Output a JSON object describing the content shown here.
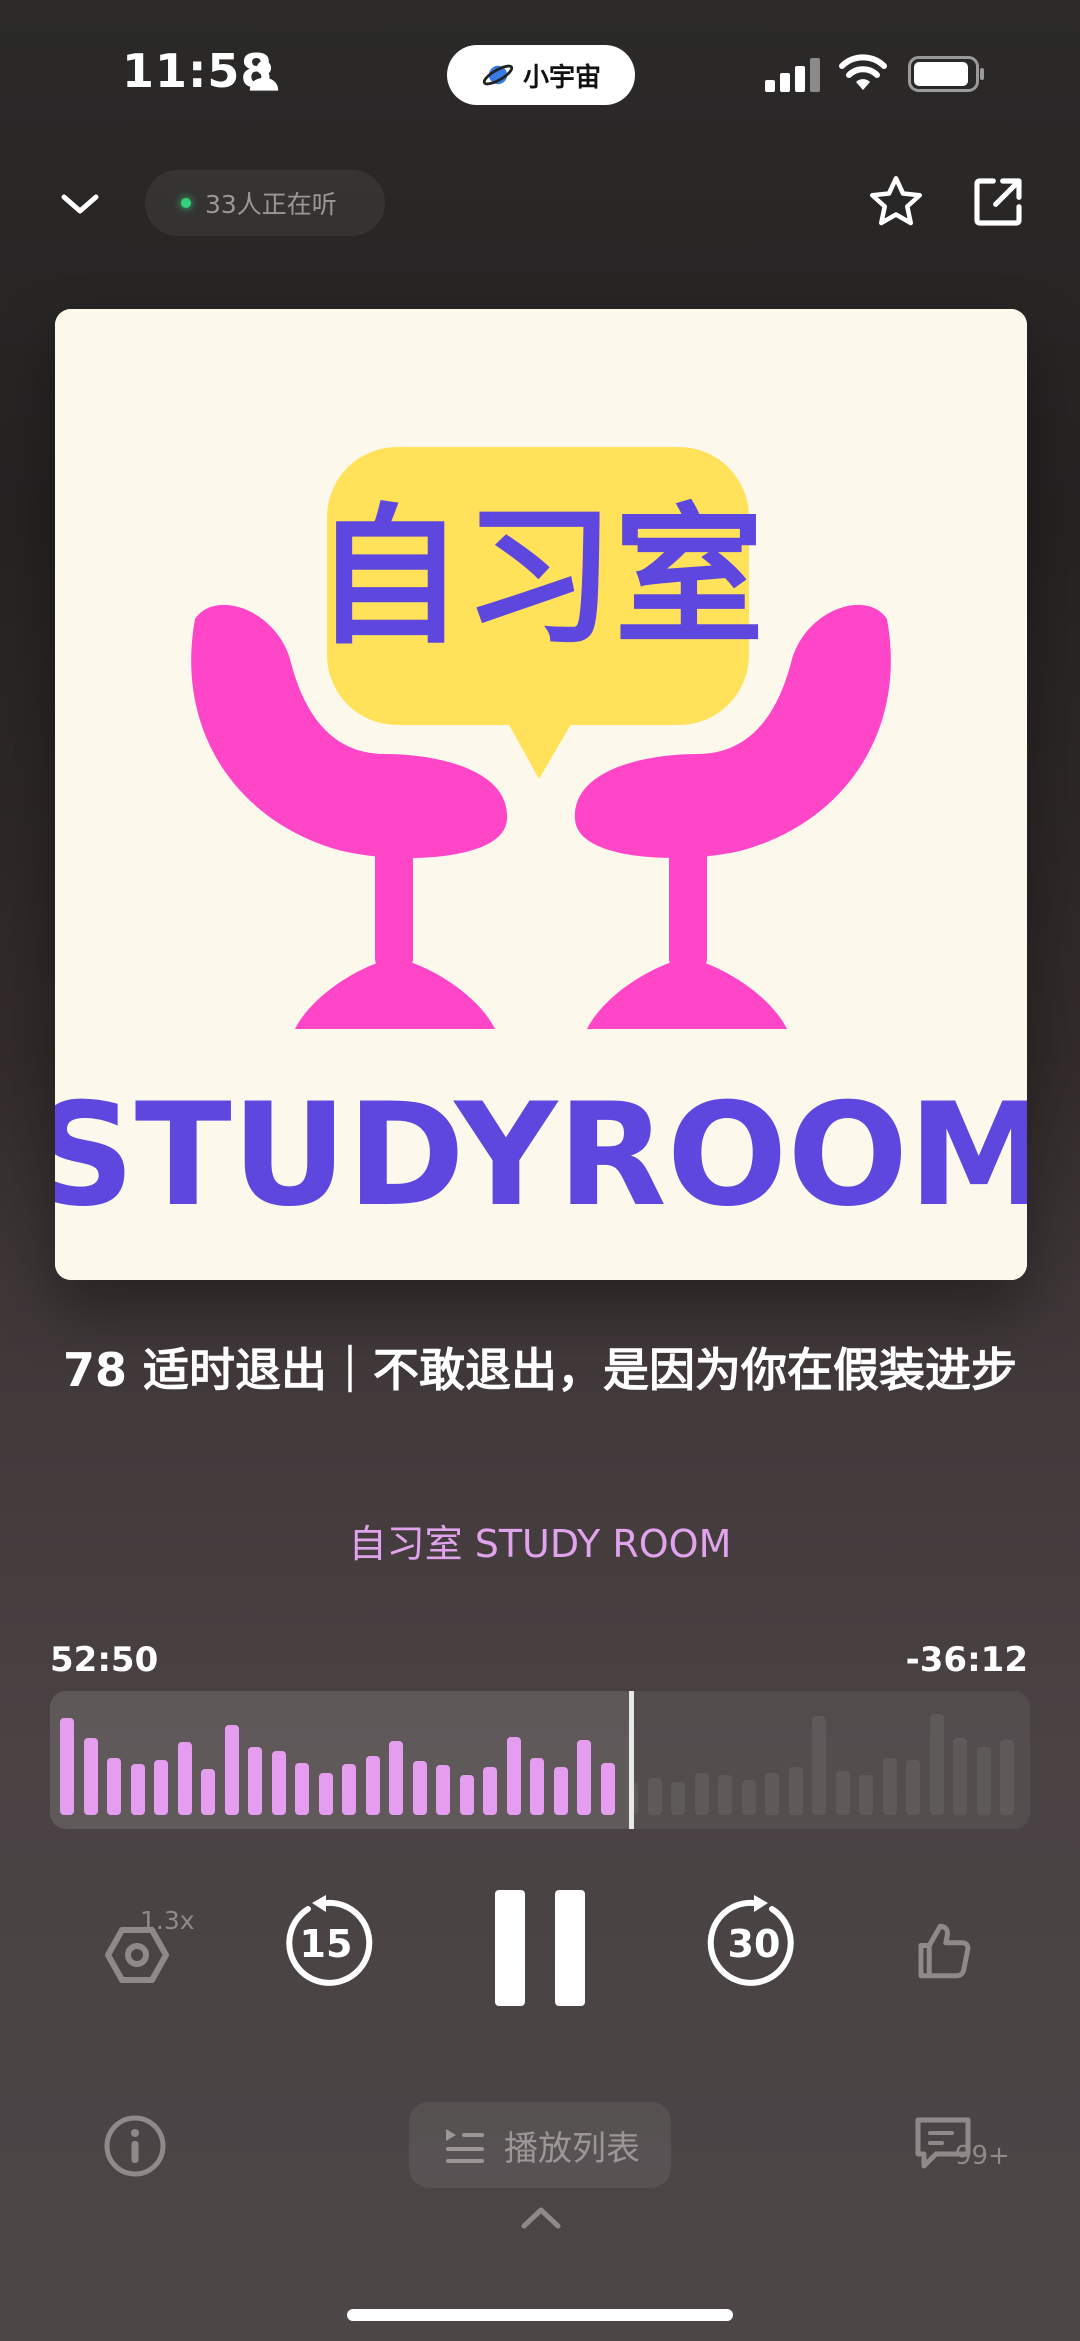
{
  "status_bar": {
    "time": "11:58",
    "app_badge": "小宇宙"
  },
  "header": {
    "listeners_text": "33人正在听"
  },
  "cover": {
    "logo_cn": "自习室",
    "logo_en": "STUDYROOM",
    "colors": {
      "background": "#fdf8ec",
      "bubble": "#ffe25a",
      "chairs": "#ff45c8",
      "text": "#5e47de"
    }
  },
  "episode": {
    "title": "78 适时退出｜不敢退出，是因为你在假装进步",
    "podcast": "自习室 STUDY ROOM"
  },
  "progress": {
    "elapsed": "52:50",
    "remaining": "-36:12",
    "played_fraction": 0.593,
    "bars_played": [
      0.88,
      0.7,
      0.52,
      0.46,
      0.5,
      0.66,
      0.42,
      0.82,
      0.62,
      0.58,
      0.47,
      0.38,
      0.46,
      0.54,
      0.67,
      0.49,
      0.45,
      0.36,
      0.44,
      0.71,
      0.52,
      0.44,
      0.68,
      0.47
    ],
    "bars_unplayed": [
      0.3,
      0.34,
      0.3,
      0.38,
      0.36,
      0.32,
      0.38,
      0.44,
      0.9,
      0.4,
      0.36,
      0.52,
      0.5,
      0.92,
      0.7,
      0.62,
      0.68
    ],
    "colors": {
      "played": "#e59df0",
      "unplayed": "#5f5a5a"
    }
  },
  "controls": {
    "speed": "1.3x",
    "rewind_seconds": "15",
    "forward_seconds": "30"
  },
  "bottom": {
    "playlist_label": "播放列表",
    "comment_count": "99+"
  }
}
